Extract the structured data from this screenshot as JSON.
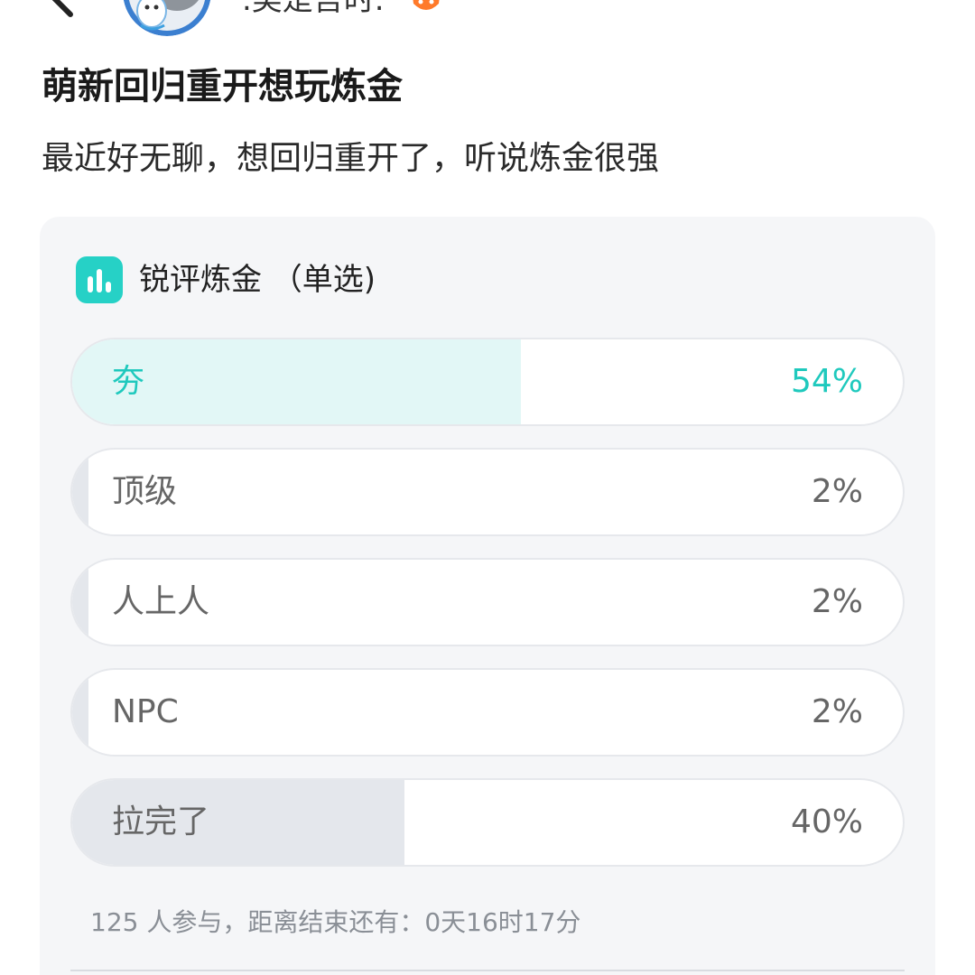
{
  "header": {
    "back_icon": "chevron-left-icon",
    "author_name": ".美是吾时.",
    "badge_icon": "fox-badge-icon",
    "more_icon": "more-vertical-icon"
  },
  "post": {
    "title": "萌新回归重开想玩炼金",
    "body": "最近好无聊，想回归重开了，听说炼金很强"
  },
  "poll": {
    "icon": "bar-chart-icon",
    "title": "锐评炼金 （单选)",
    "accent_color": "#26d1c6",
    "options": [
      {
        "label": "夯",
        "percent_text": "54%",
        "percent": 54,
        "leading": true
      },
      {
        "label": "顶级",
        "percent_text": "2%",
        "percent": 2,
        "leading": false
      },
      {
        "label": "人上人",
        "percent_text": "2%",
        "percent": 2,
        "leading": false
      },
      {
        "label": "NPC",
        "percent_text": "2%",
        "percent": 2,
        "leading": false
      },
      {
        "label": "拉完了",
        "percent_text": "40%",
        "percent": 40,
        "leading": false
      }
    ],
    "footer": "125 人参与，距离结束还有：0天16时17分"
  }
}
